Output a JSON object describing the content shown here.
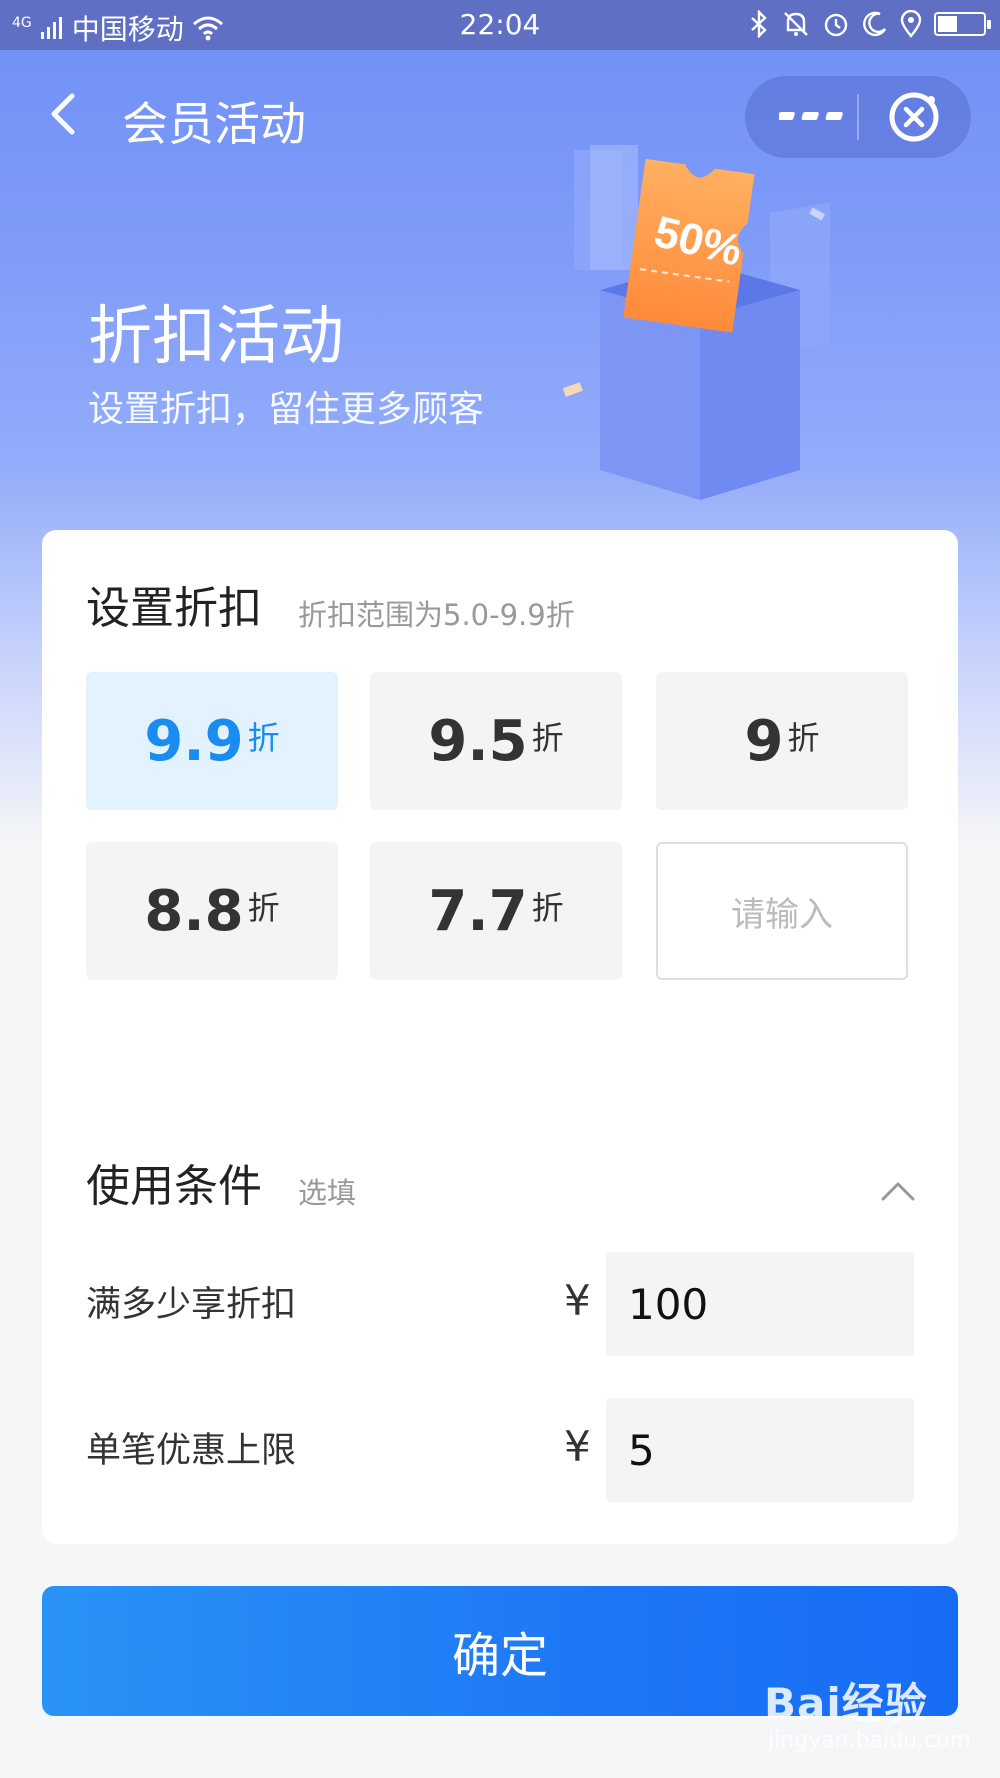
{
  "status_bar": {
    "network": "4G",
    "carrier": "中国移动",
    "time": "22:04"
  },
  "nav": {
    "title": "会员活动"
  },
  "hero": {
    "title": "折扣活动",
    "subtitle": "设置折扣，留住更多顾客",
    "ticket_text": "50%"
  },
  "discount": {
    "title": "设置折扣",
    "hint": "折扣范围为5.0-9.9折",
    "unit": "折",
    "options": [
      {
        "value": "9.9",
        "selected": true
      },
      {
        "value": "9.5",
        "selected": false
      },
      {
        "value": "9",
        "selected": false
      },
      {
        "value": "8.8",
        "selected": false
      },
      {
        "value": "7.7",
        "selected": false
      }
    ],
    "custom_placeholder": "请输入"
  },
  "conditions": {
    "title": "使用条件",
    "hint": "选填",
    "currency": "¥",
    "threshold_label": "满多少享折扣",
    "threshold_value": "100",
    "cap_label": "单笔优惠上限",
    "cap_value": "5"
  },
  "confirm_label": "确定",
  "watermark": {
    "logo": "Bai经验",
    "url": "jingyan.baidu.com"
  },
  "colors": {
    "accent": "#1a8cf0",
    "button": "#1d77f5",
    "selected_bg": "#e3f2ff",
    "hero": "#7f9cf8"
  }
}
